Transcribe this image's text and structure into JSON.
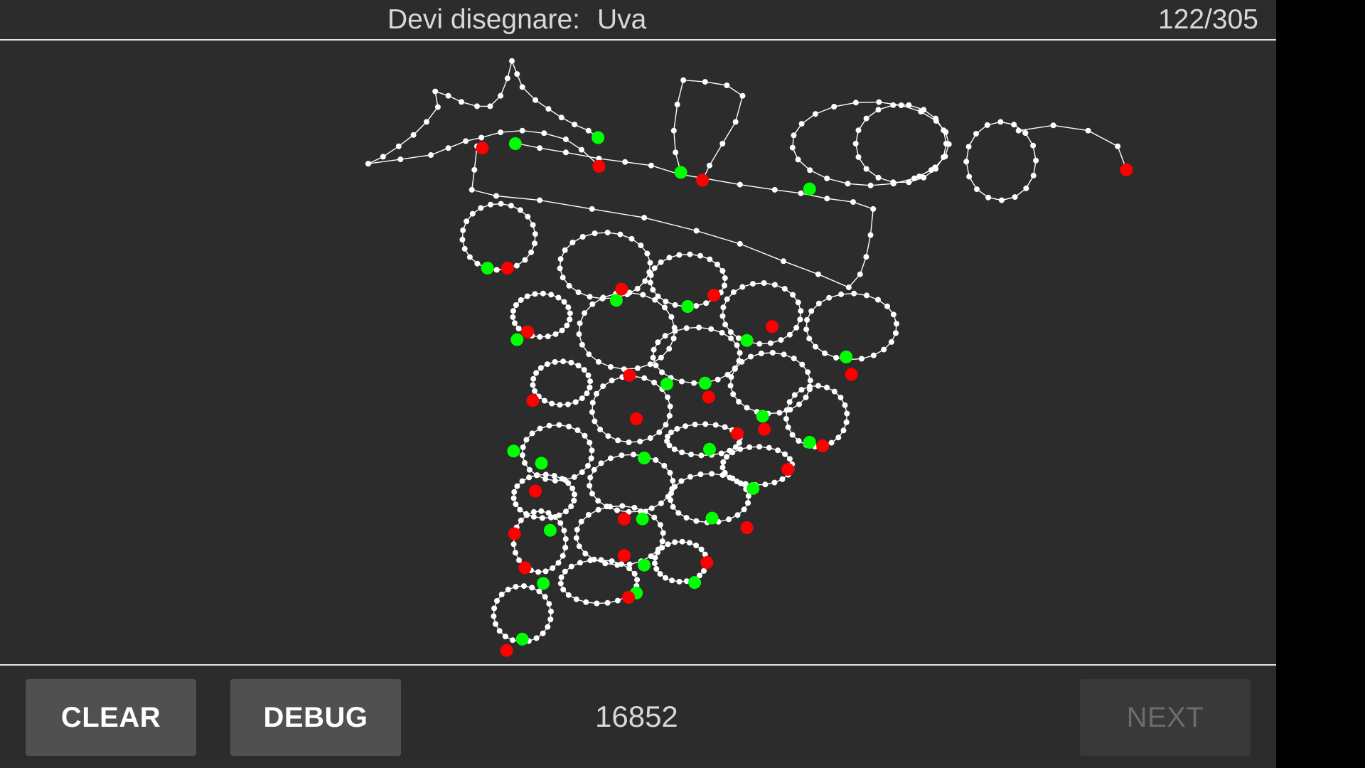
{
  "header": {
    "prompt_label": "Devi disegnare:",
    "prompt_word": "Uva",
    "progress": "122/305"
  },
  "footer": {
    "clear_label": "CLEAR",
    "debug_label": "DEBUG",
    "score": "16852",
    "next_label": "NEXT"
  },
  "colors": {
    "background": "#2c2c2c",
    "stroke": "#ffffff",
    "stroke_start": "#00ff00",
    "stroke_end": "#ff0000",
    "button": "#505050",
    "button_disabled": "#393939"
  }
}
